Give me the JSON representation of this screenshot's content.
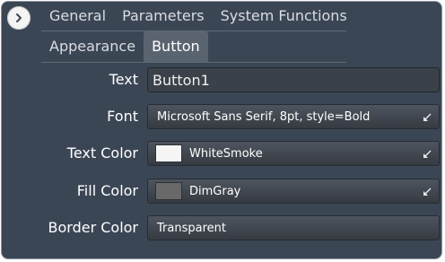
{
  "nav": {
    "expand_icon": "chevron-right-icon",
    "top_tabs": [
      "General",
      "Parameters",
      "System Functions"
    ],
    "sub_tabs": [
      "Appearance",
      "Button"
    ],
    "active_sub_tab": "Button"
  },
  "form": {
    "text_label": "Text",
    "text_value": "Button1",
    "font_label": "Font",
    "font_value": "Microsoft Sans Serif, 8pt, style=Bold",
    "text_color_label": "Text Color",
    "text_color_value": "WhiteSmoke",
    "text_color_swatch": "#f5f5f5",
    "fill_color_label": "Fill Color",
    "fill_color_value": "DimGray",
    "fill_color_swatch": "#696969",
    "border_color_label": "Border Color",
    "border_color_value": "Transparent",
    "dropdown_icon": "dropdown-corner-arrow-icon"
  },
  "colors": {
    "panel_background": "#3b4655",
    "active_tab": "#5a6470"
  }
}
